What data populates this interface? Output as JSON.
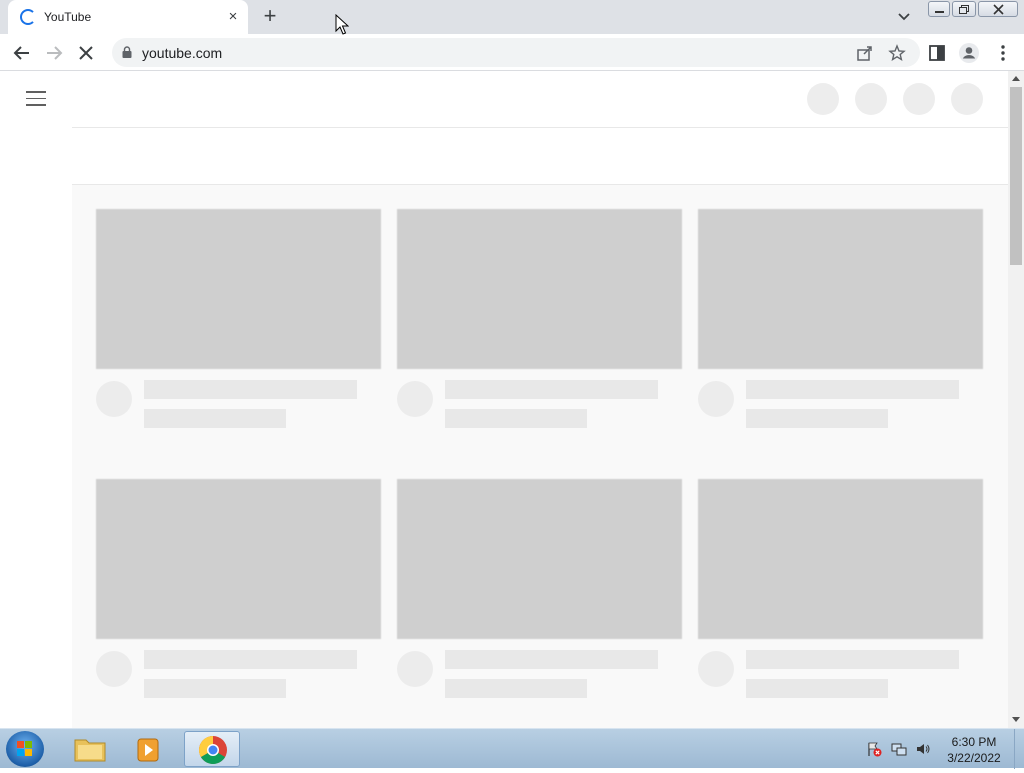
{
  "browser": {
    "tab_title": "YouTube",
    "tab_close": "×",
    "new_tab": "+",
    "url": "youtube.com"
  },
  "page": {
    "state": "loading-skeleton",
    "header_placeholders": 4,
    "video_placeholders": 6
  },
  "taskbar": {
    "apps": [
      "windows-explorer",
      "media-player",
      "google-chrome"
    ],
    "active_app": "google-chrome",
    "time": "6:30 PM",
    "date": "3/22/2022"
  },
  "colors": {
    "thumb_placeholder": "#cfcfcf",
    "text_placeholder": "#e8e8e8",
    "accent": "#1a73e8"
  }
}
